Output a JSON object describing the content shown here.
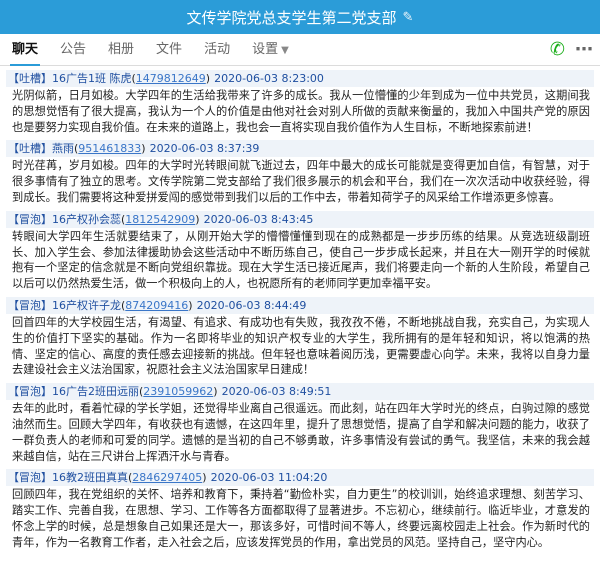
{
  "window": {
    "title": "文传学院党总支学生第二党支部"
  },
  "tabs": [
    {
      "label": "聊天"
    },
    {
      "label": "公告"
    },
    {
      "label": "相册"
    },
    {
      "label": "文件"
    },
    {
      "label": "活动"
    },
    {
      "label": "设置"
    }
  ],
  "messages": [
    {
      "tag": "【吐槽】",
      "sender": "16广告1班 陈虎",
      "qq": "1479812649",
      "time": "2020-06-03 8:23:00",
      "body": "光阴似箭，日月如梭。大学四年的生活给我带来了许多的成长。我从一位懵懂的少年到成为一位中共党员，这期间我的思想觉悟有了很大提高，我认为一个人的价值是由他对社会对别人所做的贡献来衡量的，我加入中国共产党的原因也是要努力实现自我价值。在未来的道路上，我也会一直将实现自我价值作为人生目标，不断地探索前进！"
    },
    {
      "tag": "【吐槽】",
      "sender": "燕雨",
      "qq": "951461833",
      "time": "2020-06-03 8:37:39",
      "body": "时光荏苒，岁月如梭。四年的大学时光转眼间就飞逝过去，四年中最大的成长可能就是变得更加自信，有智慧，对于很多事情有了独立的思考。文传学院第二党支部给了我们很多展示的机会和平台，我们在一次次活动中收获经验，得到成长。我们需要将这种爱拼爱闯的感觉带到我们以后的工作中去，带着知荷学子的风采给工作增添更多惊喜。"
    },
    {
      "tag": "【冒泡】",
      "sender": "16产权孙会蕊",
      "qq": "1812542909",
      "time": "2020-06-03 8:43:45",
      "body": "转眼间大学四年生活就要结束了，从刚开始大学的懵懵懂懂到现在的成熟都是一步步历练的结果。从竞选班级副班长、加入学生会、参加法律援助协会这些活动中不断历练自己，使自己一步步成长起来，并且在大一刚开学的时候就抱有一个坚定的信念就是不断向党组织靠拢。现在大学生活已接近尾声，我们将要走向一个新的人生阶段，希望自己以后可以仍然热爱生活，做一个积极向上的人，也祝愿所有的老师同学更加幸福平安。"
    },
    {
      "tag": "【冒泡】",
      "sender": "16产权许子龙",
      "qq": "874209416",
      "time": "2020-06-03 8:44:49",
      "body": "回首四年的大学校园生活，有渴望、有追求、有成功也有失败，我孜孜不倦，不断地挑战自我，充实自己，为实现人生的价值打下坚实的基础。作为一名即将毕业的知识产权专业的大学生，我所拥有的是年轻和知识，将以饱满的热情、坚定的信心、高度的责任感去迎接新的挑战。但年轻也意味着阅历浅，更需要虚心向学。未来，我将以自身力量去建设社会主义法治国家，祝愿社会主义法治国家早日建成！"
    },
    {
      "tag": "【冒泡】",
      "sender": "16广告2班田远丽",
      "qq": "2391059962",
      "time": "2020-06-03 8:49:51",
      "body": "去年的此时，看着忙碌的学长学姐，还觉得毕业离自己很遥远。而此刻，站在四年大学时光的终点，白驹过隙的感觉油然而生。回顾大学四年，有收获也有遗憾，在这四年里，提升了思想觉悟，提高了自学和解决问题的能力，收获了一群负责人的老师和可爱的同学。遗憾的是当初的自己不够勇敢，许多事情没有尝试的勇气。我坚信，未来的我会越来越自信，站在三尺讲台上挥洒汗水与青春。"
    },
    {
      "tag": "【冒泡】",
      "sender": "16教2班田真真",
      "qq": "2846297405",
      "time": "2020-06-03 11:04:20",
      "body": "回顾四年，我在党组织的关怀、培养和教育下，秉持着“勤俭朴实，自力更生”的校训训，始终追求理想、刻苦学习、踏实工作、完善自我，在思想、学习、工作等各方面都取得了显著进步。不忘初心，继续前行。临近毕业，才意发的怀念上学的时候，总是想象自己如果还是大一，那该多好，可惜时间不等人，终要远离校园走上社会。作为新时代的青年，作为一名教育工作者，走入社会之后，应该发挥党员的作用，拿出党员的风范。坚持自己，坚守内心。"
    }
  ]
}
